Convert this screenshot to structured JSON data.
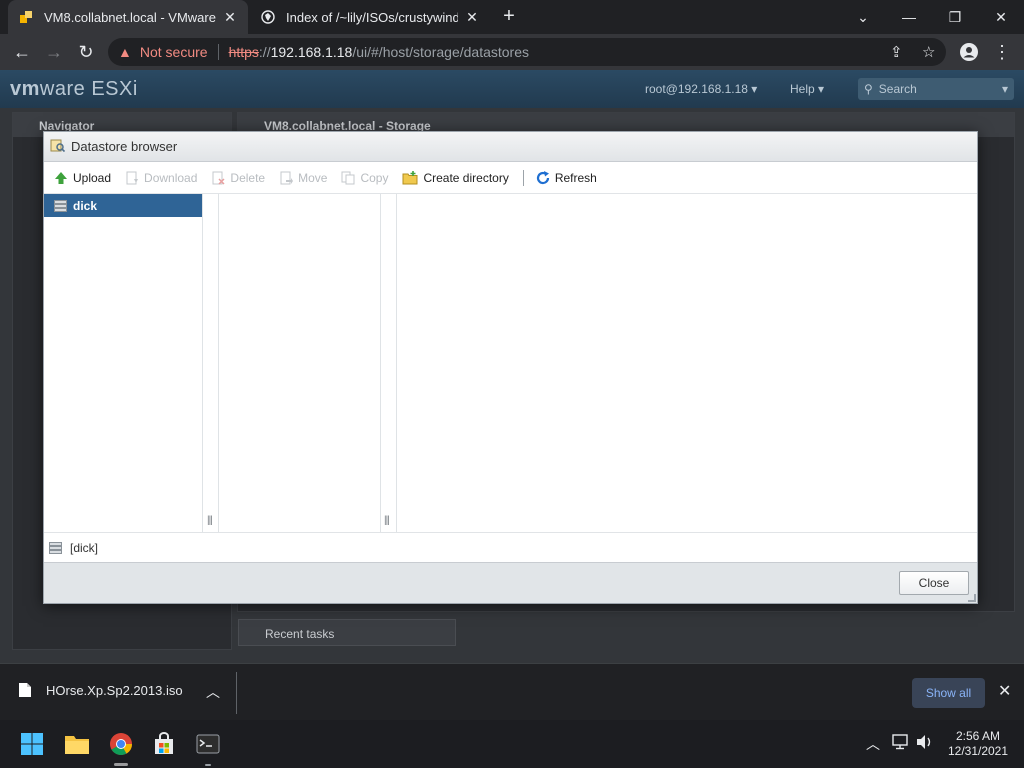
{
  "browser": {
    "tabs": [
      {
        "title": "VM8.collabnet.local - VMware ESXi",
        "active": true
      },
      {
        "title": "Index of /~lily/ISOs/crustywindows",
        "active": false
      }
    ],
    "new_tab_symbol": "+",
    "close_tab_symbol": "✕",
    "window_controls": [
      "⌄",
      "—",
      "❐",
      "✕"
    ],
    "security_label": "Not secure",
    "url": {
      "scheme": "https",
      "separator": "://",
      "host": "192.168.1.18",
      "path": "/ui/#/host/storage/datastores"
    }
  },
  "esxi": {
    "logo_brand": "vm",
    "logo_suffix": "ware  ESXi",
    "user_menu": "root@192.168.1.18",
    "help_menu": "Help",
    "search_placeholder": "Search",
    "navigator_title": "Navigator",
    "main_title": "VM8.collabnet.local - Storage",
    "recent_tasks_label": "Recent tasks"
  },
  "datastore_dialog": {
    "title": "Datastore browser",
    "toolbar": {
      "upload": "Upload",
      "download": "Download",
      "delete": "Delete",
      "move": "Move",
      "copy": "Copy",
      "create_directory": "Create directory",
      "refresh": "Refresh"
    },
    "datastores": [
      "dick"
    ],
    "selected_datastore": "dick",
    "current_path": "[dick]",
    "close_label": "Close"
  },
  "downloads": {
    "file_name": "HOrse.Xp.Sp2.2013.iso",
    "show_all_label": "Show all"
  },
  "taskbar": {
    "time": "2:56 AM",
    "date": "12/31/2021"
  },
  "colors": {
    "selection": "#2f6496",
    "refresh_blue": "#1f6fd1",
    "upload_green": "#3ea23c",
    "show_all_text": "#8ab4f8",
    "not_secure": "#f28b82"
  }
}
